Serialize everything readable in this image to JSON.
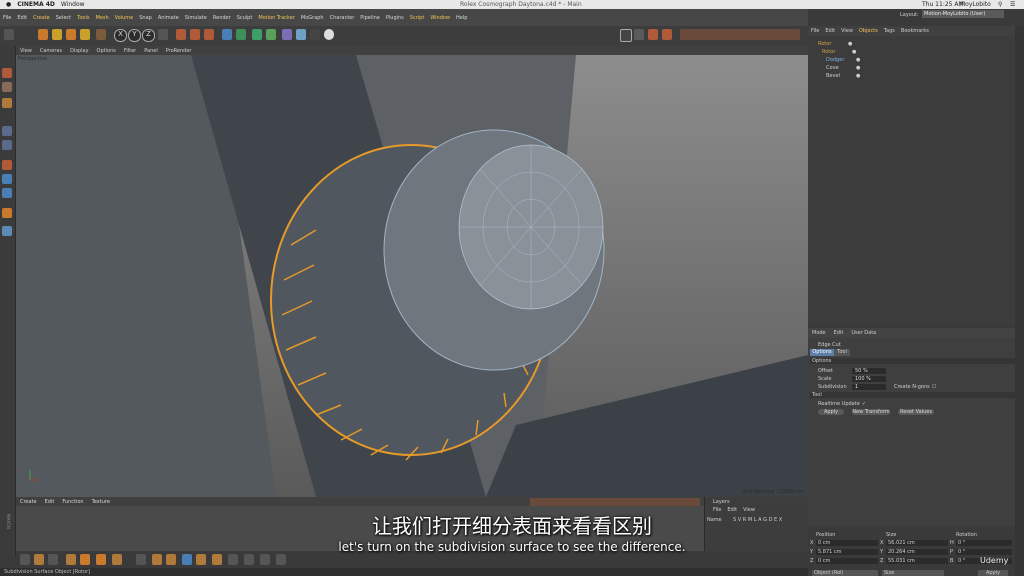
{
  "mac_menubar": {
    "app": "CINEMA 4D",
    "menu": "Window",
    "clock": "Thu 11:25 AM",
    "user": "MoyLobito"
  },
  "window": {
    "title": "Rolex Cosmograph Daytona.c4d * - Main",
    "layout_label": "Layout:",
    "layout_value": "Motion-MoyLobito (User)"
  },
  "menubar": {
    "items": [
      "File",
      "Edit",
      "Create",
      "Select",
      "Tools",
      "Mesh",
      "Volume",
      "Snap",
      "Animate",
      "Simulate",
      "Render",
      "Sculpt",
      "Motion Tracker",
      "MoGraph",
      "Character",
      "Pipeline",
      "Plugins",
      "Script",
      "Window",
      "Help"
    ],
    "highlighted": [
      "Create",
      "Tools",
      "Mesh",
      "Volume",
      "Motion Tracker",
      "Script",
      "Window"
    ]
  },
  "toolbar": {
    "axis_labels": [
      "X",
      "Y",
      "Z"
    ]
  },
  "viewport": {
    "menu": [
      "View",
      "Cameras",
      "Display",
      "Options",
      "Filter",
      "Panel",
      "ProRender"
    ],
    "label": "Perspective",
    "grid_spacing": "Grid Spacing : 10000 cm"
  },
  "timeline": {
    "menu": [
      "Create",
      "Edit",
      "Function",
      "Texture"
    ]
  },
  "layers": {
    "title": "Layers",
    "menu": [
      "File",
      "Edit",
      "View"
    ],
    "name_header": "Name",
    "flags": "S V R M L A G D E X"
  },
  "objects": {
    "tabs": [
      "File",
      "Edit",
      "View",
      "Objects",
      "Tags",
      "Bookmarks"
    ],
    "rows": [
      {
        "name": "Rotor",
        "color": "#d4a64a"
      },
      {
        "name": "Rotor",
        "color": "#d4a64a"
      },
      {
        "name": "Dodger",
        "color": "#7fb3e0"
      },
      {
        "name": "Cove",
        "color": "#cfcfcf"
      },
      {
        "name": "Bevel",
        "color": "#cfcfcf"
      }
    ]
  },
  "attributes": {
    "menu": [
      "Mode",
      "Edit",
      "User Data"
    ],
    "tool_name": "Edge Cut",
    "tabs": [
      "Options",
      "Tool"
    ],
    "options_header": "Options",
    "offset_label": "Offset",
    "offset_value": "50 %",
    "scale_label": "Scale",
    "scale_value": "100 %",
    "subdivision_label": "Subdivision",
    "subdivision_value": "1",
    "create_ngons": "Create N-gons",
    "tool_header": "Tool",
    "realtime_update": "Realtime Update",
    "buttons": [
      "Apply",
      "New Transform",
      "Reset Values"
    ]
  },
  "coordinates": {
    "headers": [
      "Position",
      "Size",
      "Rotation"
    ],
    "rows": [
      {
        "axis": "X",
        "pos": "0 cm",
        "size": "56.021 cm",
        "rot_axis": "H",
        "rot": "0 °"
      },
      {
        "axis": "Y",
        "pos": "5.871 cm",
        "size": "20.264 cm",
        "rot_axis": "P",
        "rot": "0 °"
      },
      {
        "axis": "Z",
        "pos": "0 cm",
        "size": "55.031 cm",
        "rot_axis": "B",
        "rot": "0 °"
      }
    ],
    "mode_select": "Object (Rel)",
    "size_select": "Size",
    "apply": "Apply"
  },
  "statusbar": {
    "text": "Subdivision Surface Object [Rotor]"
  },
  "subtitles": {
    "chinese": "让我们打开细分表面来看看区别",
    "english": "let's turn on the subdivision surface to see the difference."
  },
  "watermark": "Udemy"
}
